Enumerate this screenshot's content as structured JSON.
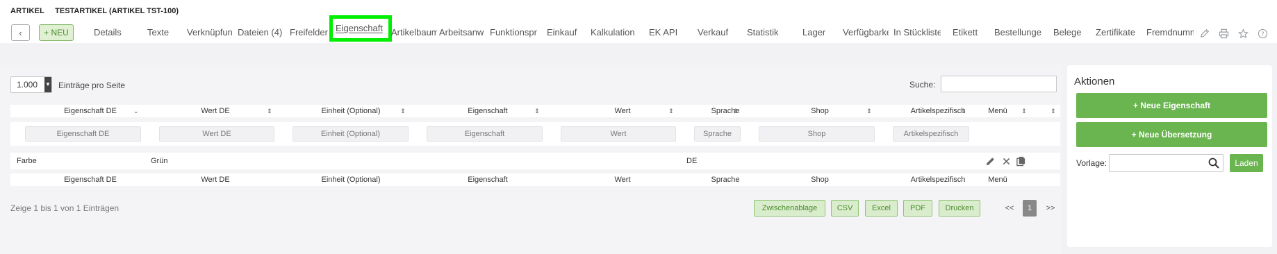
{
  "breadcrumb": {
    "section": "ARTIKEL",
    "item": "TESTARTIKEL (ARTIKEL TST-100)"
  },
  "toolbar": {
    "back_symbol": "‹",
    "new_label": "+ NEU"
  },
  "tabs": [
    {
      "label": "Details"
    },
    {
      "label": "Texte"
    },
    {
      "label": "Verknüpfun"
    },
    {
      "label": "Dateien (4)"
    },
    {
      "label": "Freifelder"
    },
    {
      "label": "Eigenschaft"
    },
    {
      "label": "Artikelbaum"
    },
    {
      "label": "Arbeitsanw"
    },
    {
      "label": "Funktionspr"
    },
    {
      "label": "Einkauf"
    },
    {
      "label": "Kalkulation"
    },
    {
      "label": "EK API"
    },
    {
      "label": "Verkauf"
    },
    {
      "label": "Statistik"
    },
    {
      "label": "Lager"
    },
    {
      "label": "Verfügbarke"
    },
    {
      "label": "In Stückliste"
    },
    {
      "label": "Etikett"
    },
    {
      "label": "Bestellunge"
    },
    {
      "label": "Belege"
    },
    {
      "label": "Zertifikate"
    },
    {
      "label": "Fremdnumm"
    }
  ],
  "active_tab": "Eigenschaft",
  "header_icons": [
    "pencil-icon",
    "print-icon",
    "star-icon",
    "help-icon"
  ],
  "list": {
    "page_size": "1.000",
    "page_size_label": "Einträge pro Seite",
    "search_label": "Suche:",
    "search_value": "",
    "columns": [
      "Eigenschaft DE",
      "Wert DE",
      "Einheit (Optional)",
      "Eigenschaft",
      "Wert",
      "Sprache",
      "Shop",
      "Artikelspezifisch",
      "Menü"
    ],
    "filters": [
      "Eigenschaft DE",
      "Wert DE",
      "Einheit (Optional)",
      "Eigenschaft",
      "Wert",
      "Sprache",
      "Shop",
      "Artikelspezifisch"
    ],
    "rows": [
      {
        "eigenschaft_de": "Farbe",
        "wert_de": "Grün",
        "einheit": "",
        "eigenschaft": "",
        "wert": "",
        "sprache": "DE",
        "shop": "",
        "artikelspezifisch": ""
      }
    ],
    "info": "Zeige 1 bis 1 von 1 Einträgen",
    "exports": [
      "Zwischenablage",
      "CSV",
      "Excel",
      "PDF",
      "Drucken"
    ],
    "pager": {
      "prev": "<<",
      "current": "1",
      "next": ">>"
    }
  },
  "actions": {
    "title": "Aktionen",
    "new_property": "+ Neue Eigenschaft",
    "new_translation": "+ Neue Übersetzung",
    "template_label": "Vorlage:",
    "template_value": "",
    "load_label": "Laden"
  },
  "colors": {
    "accent_green": "#6ab550",
    "highlight": "#00ee00"
  }
}
